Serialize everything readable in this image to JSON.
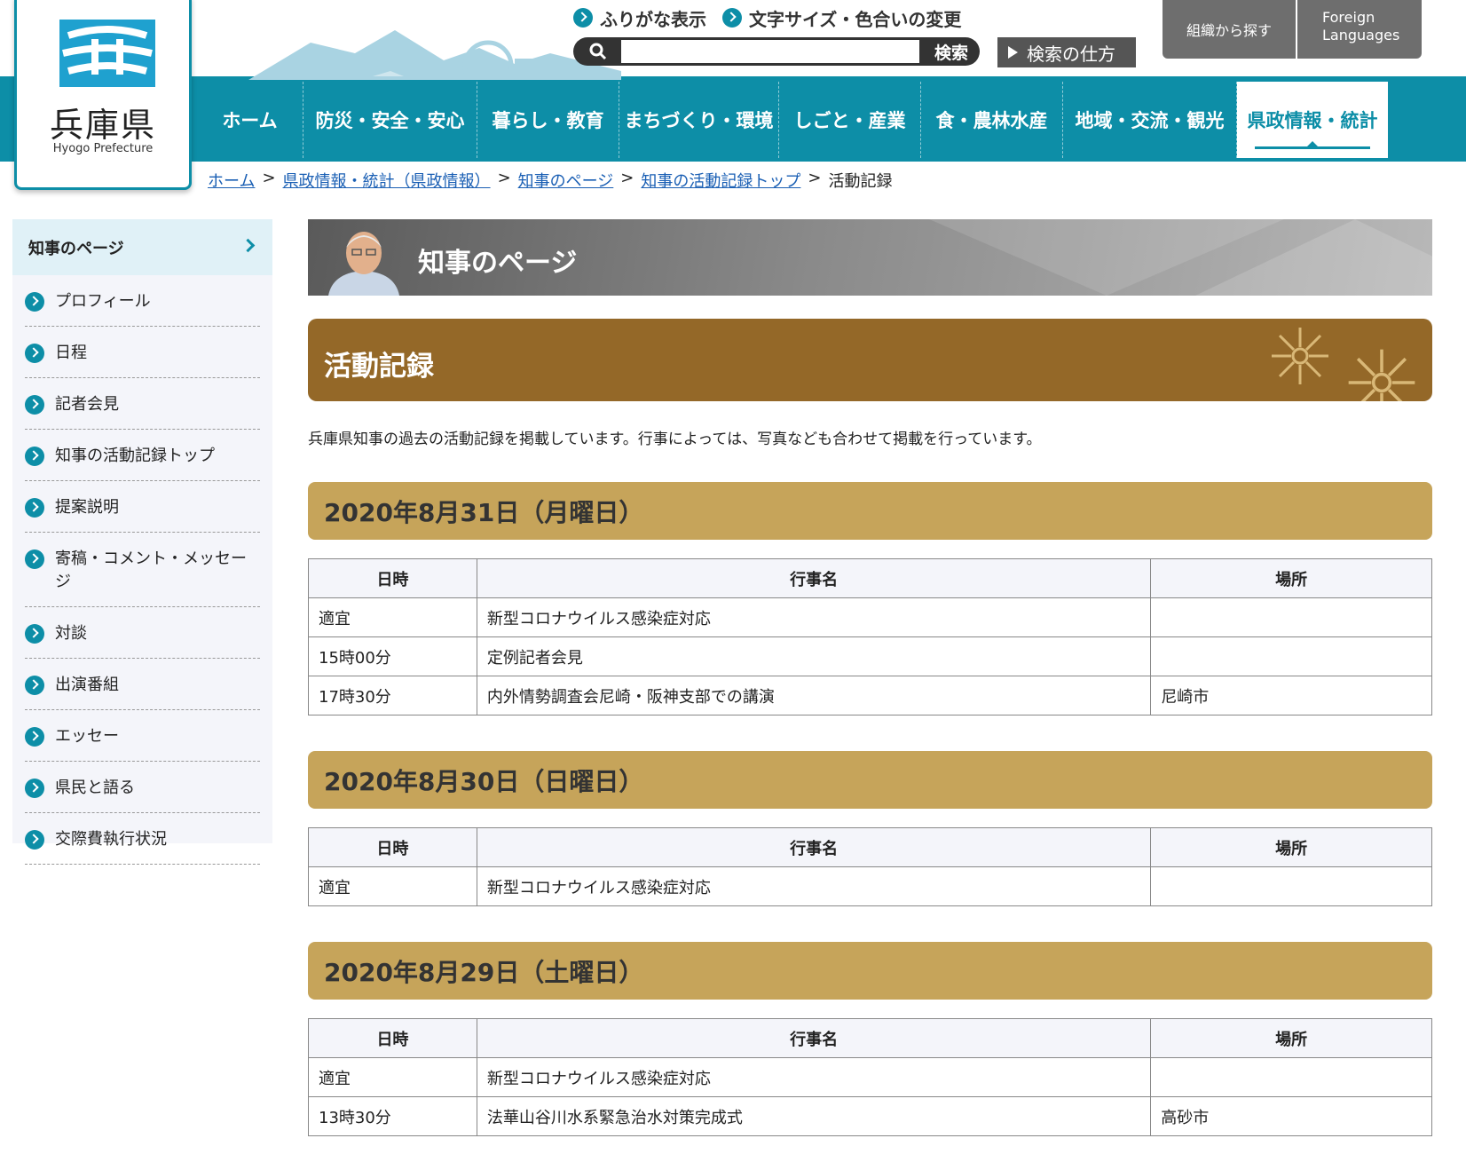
{
  "logo": {
    "jp": "兵庫県",
    "en": "Hyogo Prefecture"
  },
  "header": {
    "furigana_label": "ふりがな表示",
    "fontsize_label": "文字サイズ・色合いの変更",
    "search_placeholder": "",
    "search_button": "検索",
    "howto_label": "検索の仕方",
    "org_label": "組織から探す",
    "lang_line1": "Foreign",
    "lang_line2": "Languages",
    "colors": {
      "brand": "#0d8ea7",
      "section": "#946828",
      "dayhead": "#c6a45a"
    }
  },
  "nav": {
    "items": [
      {
        "label": "ホーム"
      },
      {
        "label": "防災・安全・安心"
      },
      {
        "label": "暮らし・教育"
      },
      {
        "label": "まちづくり・環境"
      },
      {
        "label": "しごと・産業"
      },
      {
        "label": "食・農林水産"
      },
      {
        "label": "地域・交流・観光"
      },
      {
        "label": "県政情報・統計"
      }
    ],
    "active": "県政情報・統計"
  },
  "breadcrumb": {
    "items": [
      "ホーム",
      "県政情報・統計（県政情報）",
      "知事のページ",
      "知事の活動記録トップ"
    ],
    "separator": ">",
    "current": "活動記録"
  },
  "sidebar": {
    "heading": "知事のページ",
    "items": [
      {
        "label": "プロフィール"
      },
      {
        "label": "日程"
      },
      {
        "label": "記者会見"
      },
      {
        "label": "知事の活動記録トップ"
      },
      {
        "label": "提案説明"
      },
      {
        "label": "寄稿・コメント・メッセージ"
      },
      {
        "label": "対談"
      },
      {
        "label": "出演番組"
      },
      {
        "label": "エッセー"
      },
      {
        "label": "県民と語る"
      },
      {
        "label": "交際費執行状況"
      }
    ]
  },
  "main": {
    "banner_title": "知事のページ",
    "section_title": "活動記録",
    "intro": "兵庫県知事の過去の活動記録を掲載しています。行事によっては、写真なども合わせて掲載を行っています。",
    "table_headers": {
      "time": "日時",
      "event": "行事名",
      "place": "場所"
    },
    "days": [
      {
        "date": "2020年8月31日（月曜日）",
        "rows": [
          {
            "time": "適宜",
            "event": "新型コロナウイルス感染症対応",
            "place": ""
          },
          {
            "time": "15時00分",
            "event": "定例記者会見",
            "place": ""
          },
          {
            "time": "17時30分",
            "event": "内外情勢調査会尼崎・阪神支部での講演",
            "place": "尼崎市"
          }
        ]
      },
      {
        "date": "2020年8月30日（日曜日）",
        "rows": [
          {
            "time": "適宜",
            "event": "新型コロナウイルス感染症対応",
            "place": ""
          }
        ]
      },
      {
        "date": "2020年8月29日（土曜日）",
        "rows": [
          {
            "time": "適宜",
            "event": "新型コロナウイルス感染症対応",
            "place": ""
          },
          {
            "time": "13時30分",
            "event": "法華山谷川水系緊急治水対策完成式",
            "place": "高砂市"
          }
        ]
      }
    ]
  }
}
